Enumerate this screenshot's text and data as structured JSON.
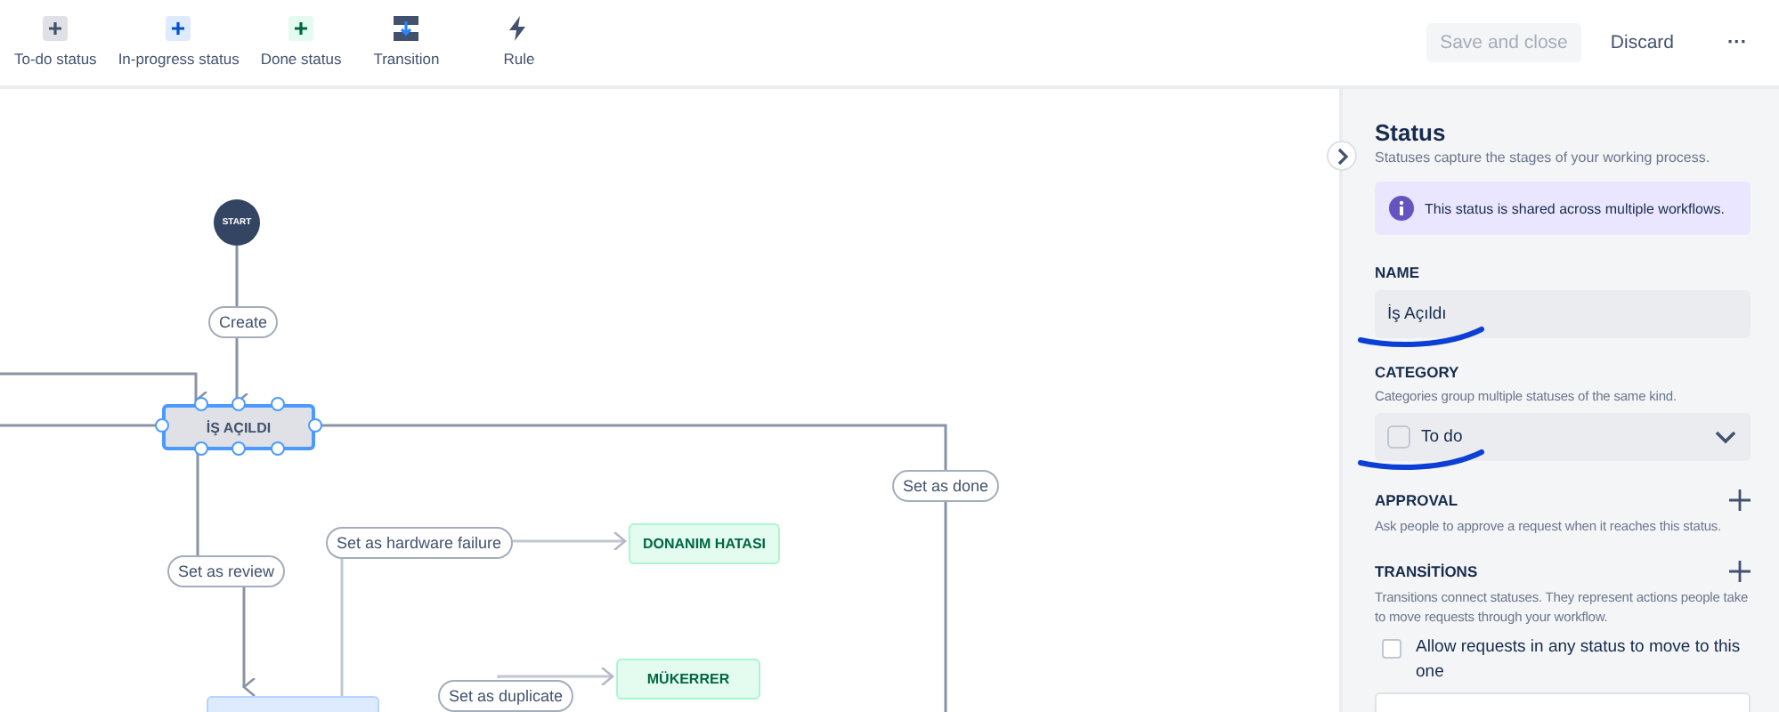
{
  "toolbar": {
    "items": [
      {
        "label": "To-do status",
        "kind": "todo"
      },
      {
        "label": "In-progress status",
        "kind": "progress"
      },
      {
        "label": "Done status",
        "kind": "done"
      },
      {
        "label": "Transition",
        "kind": "transition"
      },
      {
        "label": "Rule",
        "kind": "rule"
      }
    ],
    "actions": [
      {
        "label": "Save and close",
        "kind": "button",
        "disabled": true
      },
      {
        "label": "Discard",
        "kind": "link"
      },
      {
        "label": "···",
        "kind": "more"
      }
    ]
  },
  "canvas": {
    "start": {
      "label": "START"
    },
    "statuses": [
      {
        "label": "İŞ AÇILDI",
        "kind": "todo",
        "selected": true
      },
      {
        "label": "DONANIM HATASI",
        "kind": "done",
        "selected": false
      },
      {
        "label": "MÜKERRER",
        "kind": "done",
        "selected": false
      },
      {
        "kind": "progress",
        "selected": false
      }
    ],
    "transitions": [
      "Create",
      "Set as done",
      "Set as review",
      "Set as hardware failure",
      "Set as duplicate"
    ]
  },
  "panel": {
    "title": "Status",
    "subtitle": "Statuses capture the stages of your working process.",
    "notice": "This status is shared across multiple workflows.",
    "name": {
      "label": "NAME",
      "value": "İş Açıldı",
      "underlined": true
    },
    "category": {
      "label": "CATEGORY",
      "help": "Categories group multiple statuses of the same kind.",
      "value": "To do",
      "underlined": true
    },
    "approval": {
      "label": "APPROVAL",
      "help": "Ask people to approve a request when it reaches this status."
    },
    "transitions": {
      "label": "TRANSİTİONS",
      "help": "Transitions connect statuses. They represent actions people take to move requests through your workflow.",
      "allow_any": {
        "label": "Allow requests in any status to move to this one",
        "checked": false
      }
    }
  }
}
